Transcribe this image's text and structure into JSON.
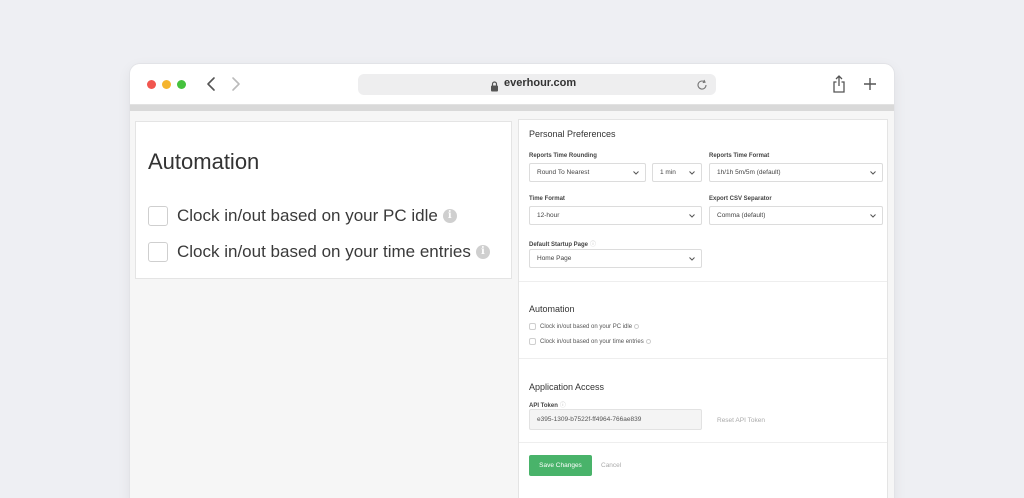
{
  "browser": {
    "url": "everhour.com",
    "icons": [
      "back-icon",
      "forward-icon",
      "lock-icon",
      "reload-icon",
      "share-icon",
      "new-tab-icon"
    ]
  },
  "automation_card": {
    "title": "Automation",
    "options": [
      {
        "label": "Clock in/out based on your PC idle",
        "checked": false
      },
      {
        "label": "Clock in/out based on your time entries",
        "checked": false
      }
    ]
  },
  "panel": {
    "preferences_title": "Personal Preferences",
    "reports_time_rounding": {
      "label": "Reports Time Rounding",
      "mode": "Round To Nearest",
      "unit": "1 min"
    },
    "reports_time_format": {
      "label": "Reports Time Format",
      "value": "1h/1h 5m/5m (default)"
    },
    "time_format": {
      "label": "Time Format",
      "value": "12-hour"
    },
    "export_csv_separator": {
      "label": "Export CSV Separator",
      "value": "Comma (default)"
    },
    "default_startup_page": {
      "label": "Default Startup Page",
      "value": "Home Page"
    },
    "automation_title": "Automation",
    "automation_options": [
      {
        "label": "Clock in/out based on your PC idle",
        "checked": false
      },
      {
        "label": "Clock in/out based on your time entries",
        "checked": false
      }
    ],
    "access_title": "Application Access",
    "api_token": {
      "label": "API Token",
      "value": "e395-1309-b7522f-ff4964-766ae839"
    },
    "reset_label": "Reset API Token",
    "save_label": "Save Changes",
    "cancel_label": "Cancel"
  },
  "colors": {
    "accent": "#49b36a",
    "background": "#eeeff3"
  }
}
